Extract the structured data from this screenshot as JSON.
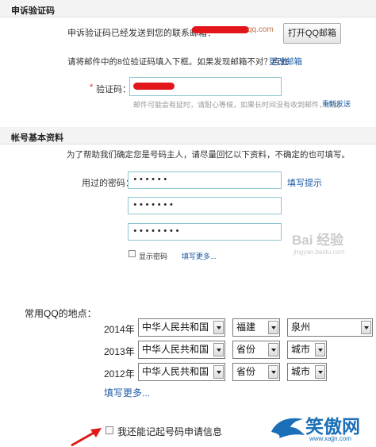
{
  "appeal_section": {
    "title": "申诉验证码",
    "sent_text": "申诉验证码已经发送到您的联系邮箱：",
    "email_suffix": "qq.com",
    "open_mail_button": "打开QQ邮箱",
    "instruction": "请将邮件中的8位验证码填入下框。如果发现邮箱不对？点此",
    "change_email_link": "更改邮箱",
    "code_label": "验证码：",
    "required_mark": "*",
    "hint": "邮件可能会有延时，请耐心等候，如果长时间没有收到邮件，点此",
    "resend_link": "重新发送"
  },
  "account_section": {
    "title": "帐号基本资料",
    "intro": "为了帮助我们确定您是号码主人，请尽量回忆以下资料，不确定的也可填写。",
    "password_label": "用过的密码：",
    "password_hint_link": "填写提示",
    "passwords": [
      "••••••",
      "•••••••",
      "••••••••"
    ],
    "show_password_label": "显示密码",
    "more_link": "填写更多..."
  },
  "location_section": {
    "label": "常用QQ的地点：",
    "rows": [
      {
        "year": "2014年",
        "country": "中华人民共和国",
        "province": "福建",
        "city": "泉州"
      },
      {
        "year": "2013年",
        "country": "中华人民共和国",
        "province": "省份",
        "city": "城市"
      },
      {
        "year": "2012年",
        "country": "中华人民共和国",
        "province": "省份",
        "city": "城市"
      }
    ],
    "more_link": "填写更多..."
  },
  "remember_checkbox_label": "我还能记起号码申请信息",
  "watermarks": {
    "baidu": "Bai 经验",
    "baidu_url": "jingyan.baidu.com",
    "site_name": "笑傲网",
    "site_url": "www.xajjn.com"
  }
}
